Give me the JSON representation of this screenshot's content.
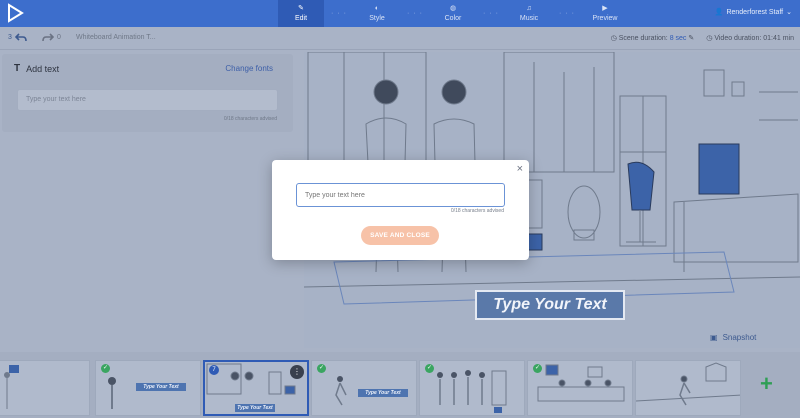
{
  "topbar": {
    "steps": [
      {
        "label": "Edit",
        "icon": "pencil-icon",
        "active": true
      },
      {
        "label": "Style",
        "icon": "palette-icon",
        "active": false
      },
      {
        "label": "Color",
        "icon": "color-drop-icon",
        "active": false
      },
      {
        "label": "Music",
        "icon": "music-note-icon",
        "active": false
      },
      {
        "label": "Preview",
        "icon": "play-icon",
        "active": false
      }
    ],
    "user_label": "Renderforest Staff"
  },
  "subbar": {
    "undo_count": "3",
    "redo_count": "0",
    "project_title": "Whiteboard Animation T...",
    "scene_duration_label": "Scene duration:",
    "scene_duration_value": "8 sec",
    "video_duration_label": "Video duration:",
    "video_duration_value": "01:41 min"
  },
  "left_panel": {
    "title": "Add text",
    "change_fonts": "Change fonts",
    "input_placeholder": "Type your text here",
    "char_count": "0/18 characters advised"
  },
  "preview": {
    "banner_text": "Type Your Text",
    "snapshot_label": "Snapshot"
  },
  "timeline": {
    "thumbs": [
      {
        "banner": "",
        "checked": false
      },
      {
        "banner": "Type Your Text",
        "checked": true
      },
      {
        "banner": "Type Your Text",
        "checked": false,
        "badge": "7"
      },
      {
        "banner": "Type Your Text",
        "checked": true
      },
      {
        "banner": "",
        "checked": true
      },
      {
        "banner": "",
        "checked": true
      },
      {
        "banner": "",
        "checked": false
      }
    ],
    "add_label": "+"
  },
  "modal": {
    "input_placeholder": "Type your text here",
    "char_count": "0/18 characters advised",
    "save_label": "SAVE AND CLOSE",
    "close_symbol": "×"
  },
  "colors": {
    "accent": "#3d6ecc",
    "success": "#3aa561",
    "save_button": "#f7c2a8"
  }
}
